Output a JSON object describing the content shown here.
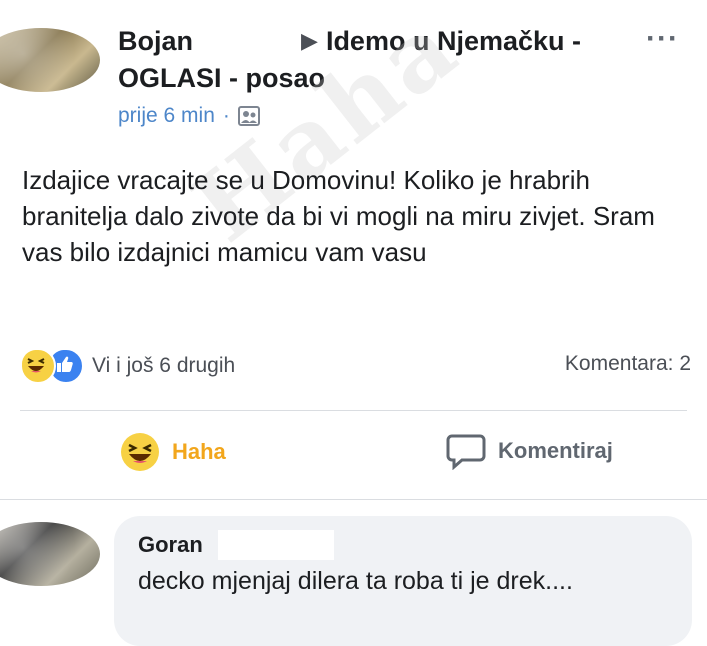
{
  "post": {
    "author": "Bojan",
    "target": "Idemo u Njemačku - OGLASI - posao",
    "time": "prije 6 min",
    "text": "Izdajice vracajte se u Domovinu! Koliko je hrabrih branitelja dalo zivote da bi vi mogli na miru zivjet. Sram vas bilo izdajnici  mamicu vam vasu",
    "watermark": "Haha",
    "menu_icon": "more-dots-icon",
    "audience_icon": "photo-icon"
  },
  "reactions": {
    "summary": "Vi i još 6 drugih",
    "comments_count": "Komentara: 2",
    "icons": [
      "haha-icon",
      "like-icon"
    ]
  },
  "actions": {
    "haha_label": "Haha",
    "comment_label": "Komentiraj",
    "colors": {
      "haha": "#f2a61c",
      "comment": "#606770",
      "link": "#4d86c9"
    }
  },
  "comment": {
    "author": "Goran",
    "text": "decko mjenjaj dilera ta roba ti je drek...."
  }
}
